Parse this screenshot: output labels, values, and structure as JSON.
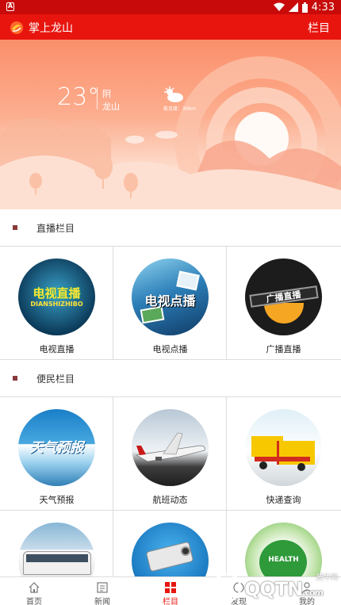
{
  "status_bar": {
    "time": "4:33"
  },
  "header": {
    "title": "掌上龙山",
    "menu_label": "栏目"
  },
  "weather": {
    "temperature": "23°",
    "condition": "阴",
    "location": "龙山",
    "visibility": "能见度：30km"
  },
  "sections": [
    {
      "title": "直播栏目",
      "items": [
        {
          "label": "电视直播",
          "art_text": "电视直播",
          "art_subtext": "DIANSHIZHIBO"
        },
        {
          "label": "电视点播",
          "art_text": "电视点播"
        },
        {
          "label": "广播直播",
          "art_text": "广播直播"
        }
      ]
    },
    {
      "title": "便民栏目",
      "items": [
        {
          "label": "天气预报",
          "art_text": "天气预报"
        },
        {
          "label": "航班动态"
        },
        {
          "label": "快递查询"
        },
        {
          "label": ""
        },
        {
          "label": ""
        },
        {
          "label": "",
          "art_text": "HEALTH"
        }
      ]
    }
  ],
  "bottom_nav": [
    {
      "label": "首页",
      "icon": "home-icon"
    },
    {
      "label": "新闻",
      "icon": "news-icon"
    },
    {
      "label": "栏目",
      "icon": "grid-icon",
      "active": true
    },
    {
      "label": "发现",
      "icon": "discover-icon"
    },
    {
      "label": "我的",
      "icon": "user-icon"
    }
  ],
  "watermark": {
    "brand": "QQTN",
    "suffix": ".com",
    "note": "腾牛网"
  },
  "colors": {
    "primary": "#e8150f",
    "status_bar": "#c80a0a",
    "section_marker": "#8a3a3a"
  }
}
